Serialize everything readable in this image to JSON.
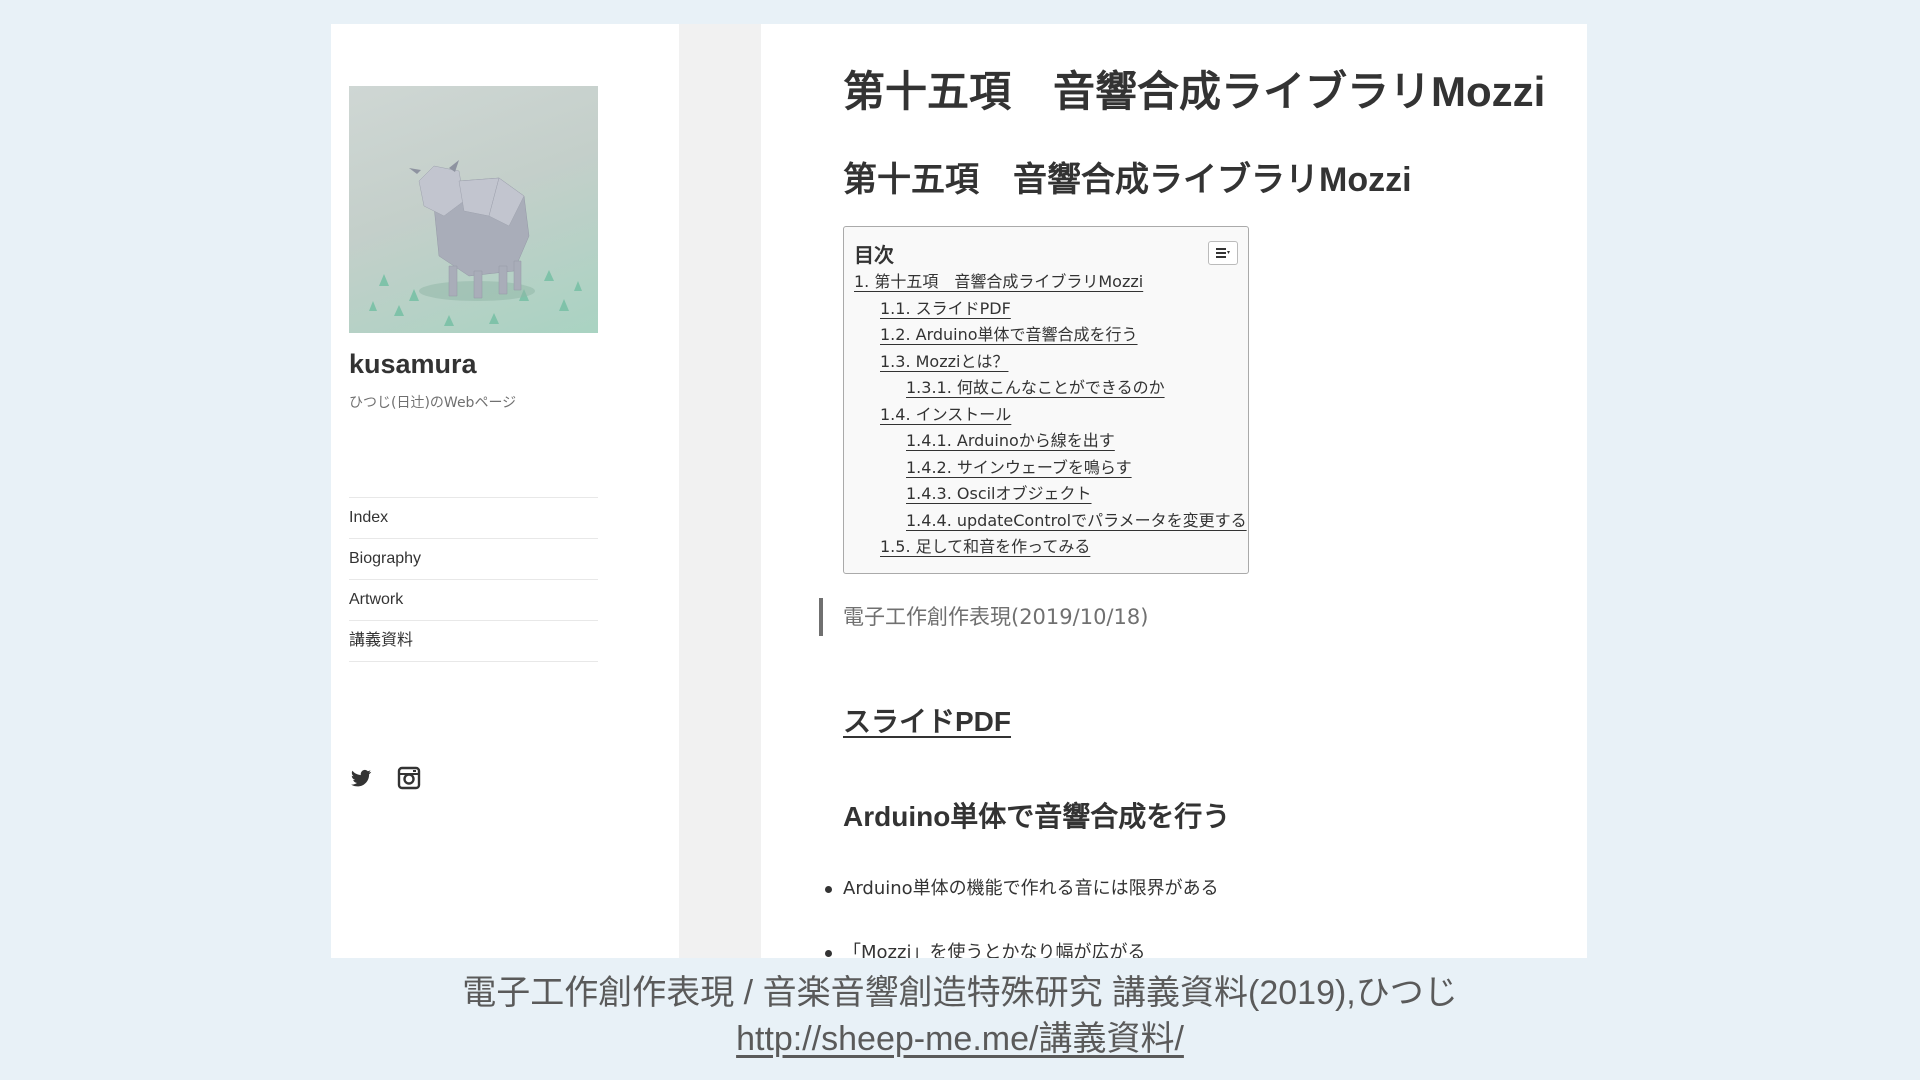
{
  "sidebar": {
    "site_title": "kusamura",
    "site_description": "ひつじ(日辻)のWebページ",
    "nav": [
      "Index",
      "Biography",
      "Artwork",
      "講義資料"
    ],
    "social_icons": [
      "twitter-icon",
      "instagram-icon"
    ]
  },
  "content": {
    "page_title": "第十五項　音響合成ライブラリMozzi",
    "heading": "第十五項　音響合成ライブラリMozzi",
    "toc": {
      "title": "目次",
      "toggle_icon": "list-icon",
      "items": [
        "1. 第十五項　音響合成ライブラリMozzi",
        "1.1. スライドPDF",
        "1.2. Arduino単体で音響合成を行う",
        "1.3. Mozziとは？",
        "1.3.1. 何故こんなことができるのか",
        "1.4. インストール",
        "1.4.1. Arduinoから線を出す",
        "1.4.2. サインウェーブを鳴らす",
        "1.4.3. Oscilオブジェクト",
        "1.4.4. updateControlでパラメータを変更する",
        "1.5. 足して和音を作ってみる"
      ]
    },
    "quote": "電子工作創作表現(2019/10/18)",
    "section_slide": "スライドPDF",
    "section_arduino": "Arduino単体で音響合成を行う",
    "bullets": [
      "Arduino単体の機能で作れる音には限界がある",
      "「Mozzi」を使うとかなり幅が広がる"
    ]
  },
  "caption": {
    "line1": "電子工作創作表現 / 音楽音響創造特殊研究 講義資料(2019),ひつじ",
    "url": "http://sheep-me.me/講義資料/"
  }
}
